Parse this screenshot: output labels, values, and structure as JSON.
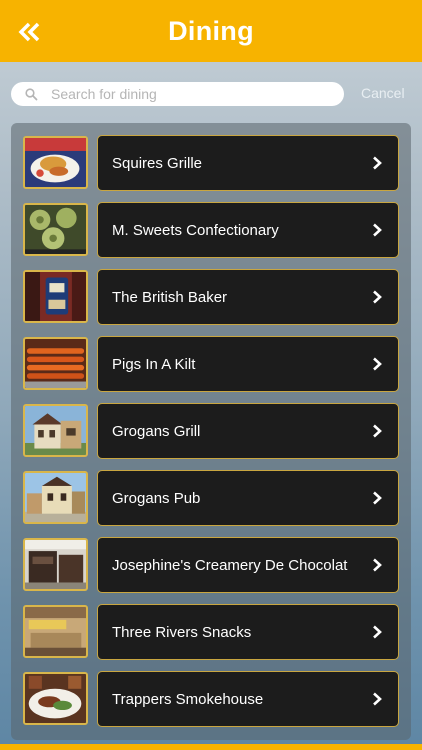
{
  "header": {
    "title": "Dining",
    "back_icon": "double-chevron-left-icon"
  },
  "search": {
    "placeholder": "Search for dining",
    "value": "",
    "cancel_label": "Cancel"
  },
  "colors": {
    "header": "#f7b300",
    "item_border": "#c9a640",
    "item_bg": "#1c1c1c"
  },
  "items": [
    {
      "label": "Squires Grille",
      "thumb": "food-platter"
    },
    {
      "label": "M. Sweets Confectionary",
      "thumb": "sweets"
    },
    {
      "label": "The British Baker",
      "thumb": "bakery-sign"
    },
    {
      "label": "Pigs In A Kilt",
      "thumb": "sausages"
    },
    {
      "label": "Grogans Grill",
      "thumb": "building"
    },
    {
      "label": "Grogans Pub",
      "thumb": "pub"
    },
    {
      "label": "Josephine's Creamery De Chocolat",
      "thumb": "creamery"
    },
    {
      "label": "Three Rivers Snacks",
      "thumb": "snack-stand"
    },
    {
      "label": "Trappers Smokehouse",
      "thumb": "bbq-plate"
    }
  ]
}
